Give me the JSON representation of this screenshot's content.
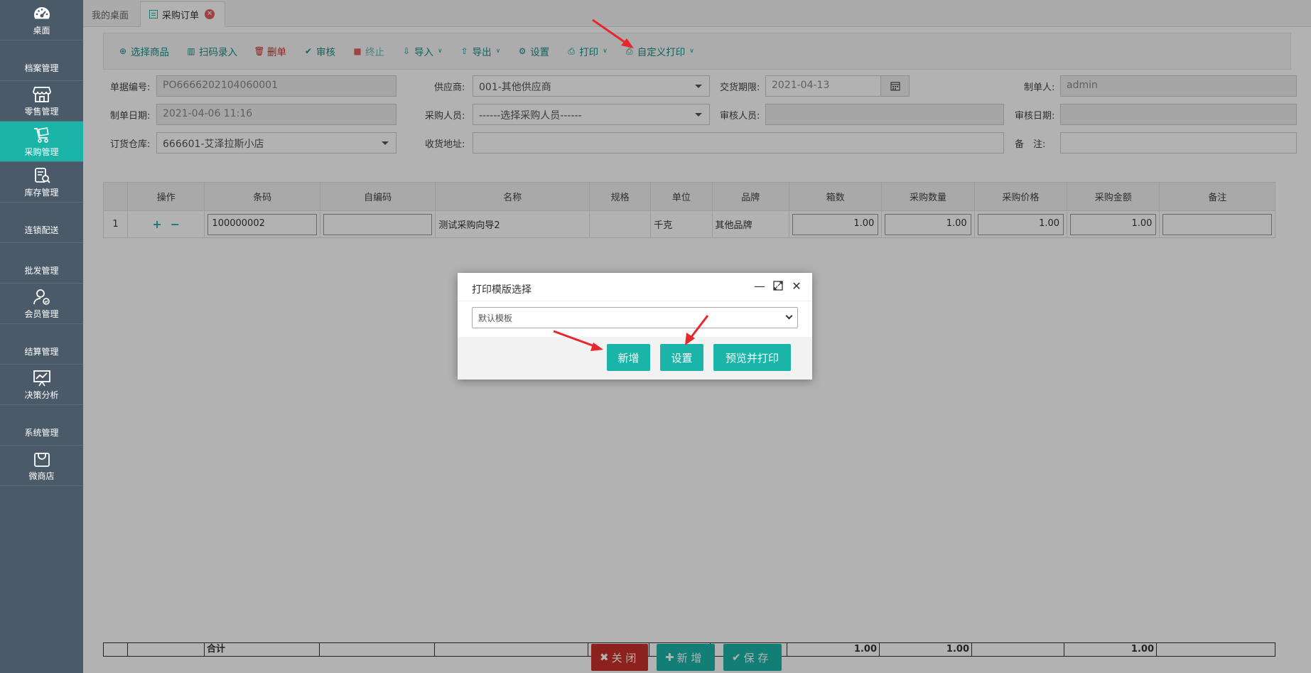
{
  "sidebar": {
    "items": [
      {
        "label": "桌面",
        "icon": "dashboard-icon"
      },
      {
        "label": "档案管理"
      },
      {
        "label": "零售管理",
        "icon": "store-icon"
      },
      {
        "label": "采购管理",
        "icon": "cart-icon",
        "active": true
      },
      {
        "label": "库存管理",
        "icon": "inventory-icon"
      },
      {
        "label": "连锁配送"
      },
      {
        "label": "批发管理"
      },
      {
        "label": "会员管理",
        "icon": "member-icon"
      },
      {
        "label": "结算管理"
      },
      {
        "label": "决策分析",
        "icon": "chart-icon"
      },
      {
        "label": "系统管理"
      },
      {
        "label": "微商店",
        "icon": "shop-bag-icon"
      }
    ]
  },
  "tabs": [
    {
      "label": "我的桌面"
    },
    {
      "label": "采购订单",
      "active": true
    }
  ],
  "toolbar": {
    "select_goods": "选择商品",
    "scan_entry": "扫码录入",
    "delete": "删单",
    "audit": "审核",
    "terminate": "终止",
    "import": "导入",
    "export": "导出",
    "settings": "设置",
    "print": "打印",
    "custom_print": "自定义打印"
  },
  "form": {
    "doc_no_label": "单据编号:",
    "doc_no": "PO6666202104060001",
    "supplier_label": "供应商:",
    "supplier": "001-其他供应商",
    "delivery_label": "交货期限:",
    "delivery": "2021-04-13",
    "maker_label": "制单人:",
    "maker": "admin",
    "make_date_label": "制单日期:",
    "make_date": "2021-04-06 11:16",
    "buyer_label": "采购人员:",
    "buyer": "------选择采购人员------",
    "auditor_label": "审核人员:",
    "auditor": "",
    "audit_date_label": "审核日期:",
    "audit_date": "",
    "warehouse_label": "订货仓库:",
    "warehouse": "666601-艾泽拉斯小店",
    "address_label": "收货地址:",
    "address": "",
    "remark_label": "备　注:",
    "remark": ""
  },
  "table": {
    "headers": [
      "",
      "操作",
      "条码",
      "自编码",
      "名称",
      "规格",
      "单位",
      "品牌",
      "箱数",
      "采购数量",
      "采购价格",
      "采购金额",
      "备注"
    ],
    "rows": [
      {
        "no": "1",
        "barcode": "100000002",
        "code": "",
        "name": "测试采购向导2",
        "spec": "",
        "unit": "千克",
        "brand": "其他品牌",
        "boxes": "1.00",
        "qty": "1.00",
        "price": "1.00",
        "amount": "1.00",
        "note": ""
      }
    ],
    "sum_label": "合计",
    "sum_boxes": "1.00",
    "sum_qty": "1.00",
    "sum_amount": "1.00"
  },
  "footer": {
    "close": "关 闭",
    "add": "新 增",
    "save": "保 存"
  },
  "dialog": {
    "title": "打印模版选择",
    "template": "默认模板",
    "btn_new": "新增",
    "btn_settings": "设置",
    "btn_preview": "预览并打印"
  },
  "colors": {
    "accent": "#1ab5a8",
    "sidebar": "#4a5a68",
    "danger": "#c9302c"
  }
}
